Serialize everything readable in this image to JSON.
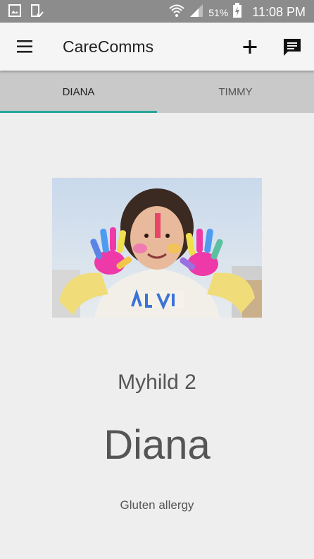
{
  "status_bar": {
    "battery_percent": "51%",
    "time": "11:08 PM",
    "icons": [
      "image-icon",
      "tablet-check-icon",
      "wifi-icon",
      "signal-icon",
      "battery-charging-icon"
    ]
  },
  "appbar": {
    "title": "CareComms",
    "icons": [
      "menu-icon",
      "add-icon",
      "message-icon"
    ]
  },
  "tabs": [
    {
      "label": "DIANA",
      "selected": true
    },
    {
      "label": "TIMMY",
      "selected": false
    }
  ],
  "profile": {
    "subtitle": "Myhild 2",
    "name": "Diana",
    "note": "Gluten allergy"
  },
  "colors": {
    "accent": "#26a69a",
    "status_bar": "#8c8c8c",
    "tab_bar": "#c9c9c9"
  }
}
